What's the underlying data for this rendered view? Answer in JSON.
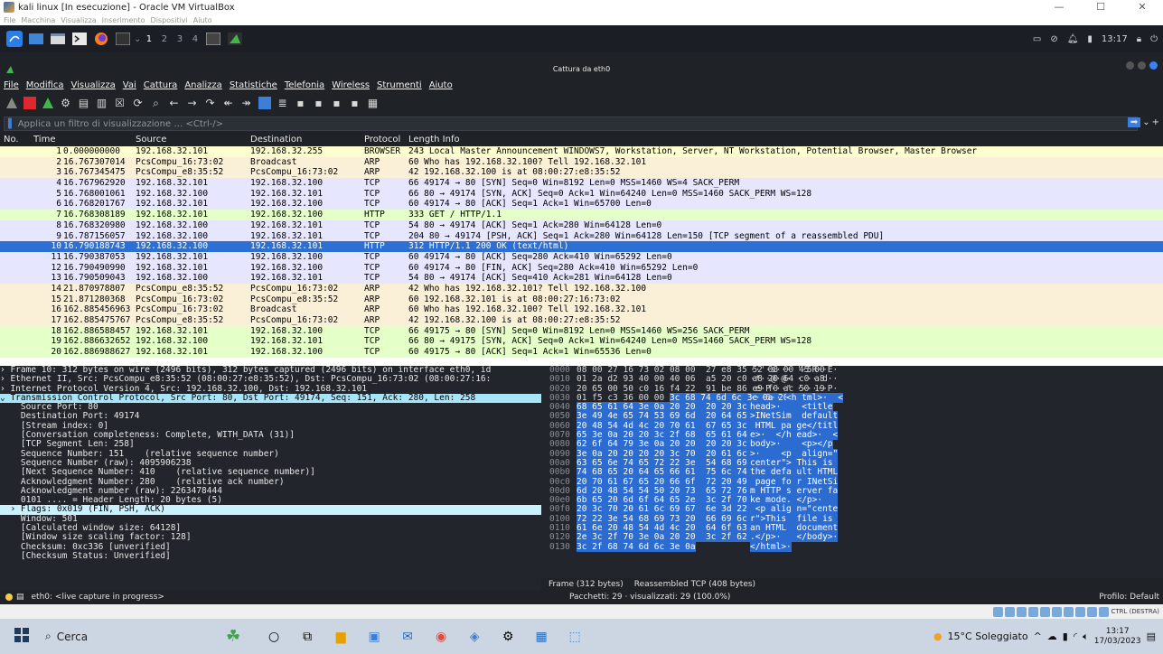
{
  "vbox": {
    "title": "kali linux [In esecuzione] - Oracle VM VirtualBox",
    "menu": [
      "File",
      "Macchina",
      "Visualizza",
      "Inserimento",
      "Dispositivi",
      "Aiuto"
    ]
  },
  "kali_panel": {
    "workspaces": [
      "1",
      "2",
      "3",
      "4"
    ],
    "time": "13:17"
  },
  "wireshark": {
    "window_title": "Cattura da eth0",
    "menu": [
      "File",
      "Modifica",
      "Visualizza",
      "Vai",
      "Cattura",
      "Analizza",
      "Statistiche",
      "Telefonia",
      "Wireless",
      "Strumenti",
      "Aiuto"
    ],
    "filter_placeholder": "Applica un filtro di visualizzazione … <Ctrl-/>",
    "columns": {
      "no": "No.",
      "time": "Time",
      "src": "Source",
      "dst": "Destination",
      "proto": "Protocol",
      "len_info": "Length Info"
    },
    "packets": [
      {
        "no": "1",
        "time": "0.000000000",
        "src": "192.168.32.101",
        "dst": "192.168.32.255",
        "proto": "BROWSER",
        "info": "243 Local Master Announcement WINDOWS7, Workstation, Server, NT Workstation, Potential Browser, Master Browser",
        "bg": "#feffd0"
      },
      {
        "no": "2",
        "time": "16.767307014",
        "src": "PcsCompu_16:73:02",
        "dst": "Broadcast",
        "proto": "ARP",
        "info": "60 Who has 192.168.32.100? Tell 192.168.32.101",
        "bg": "#faf0d7"
      },
      {
        "no": "3",
        "time": "16.767345475",
        "src": "PcsCompu_e8:35:52",
        "dst": "PcsCompu_16:73:02",
        "proto": "ARP",
        "info": "42 192.168.32.100 is at 08:00:27:e8:35:52",
        "bg": "#faf0d7"
      },
      {
        "no": "4",
        "time": "16.767962920",
        "src": "192.168.32.101",
        "dst": "192.168.32.100",
        "proto": "TCP",
        "info": "66 49174 → 80 [SYN] Seq=0 Win=8192 Len=0 MSS=1460 WS=4 SACK_PERM",
        "bg": "#e7e6ff"
      },
      {
        "no": "5",
        "time": "16.768001061",
        "src": "192.168.32.100",
        "dst": "192.168.32.101",
        "proto": "TCP",
        "info": "66 80 → 49174 [SYN, ACK] Seq=0 Ack=1 Win=64240 Len=0 MSS=1460 SACK_PERM WS=128",
        "bg": "#e7e6ff"
      },
      {
        "no": "6",
        "time": "16.768201767",
        "src": "192.168.32.101",
        "dst": "192.168.32.100",
        "proto": "TCP",
        "info": "60 49174 → 80 [ACK] Seq=1 Ack=1 Win=65700 Len=0",
        "bg": "#e7e6ff"
      },
      {
        "no": "7",
        "time": "16.768308189",
        "src": "192.168.32.101",
        "dst": "192.168.32.100",
        "proto": "HTTP",
        "info": "333 GET / HTTP/1.1",
        "bg": "#e4ffc7"
      },
      {
        "no": "8",
        "time": "16.768320980",
        "src": "192.168.32.100",
        "dst": "192.168.32.101",
        "proto": "TCP",
        "info": "54 80 → 49174 [ACK] Seq=1 Ack=280 Win=64128 Len=0",
        "bg": "#e7e6ff"
      },
      {
        "no": "9",
        "time": "16.787156057",
        "src": "192.168.32.100",
        "dst": "192.168.32.101",
        "proto": "TCP",
        "info": "204 80 → 49174 [PSH, ACK] Seq=1 Ack=280 Win=64128 Len=150 [TCP segment of a reassembled PDU]",
        "bg": "#e7e6ff"
      },
      {
        "no": "10",
        "time": "16.790188743",
        "src": "192.168.32.100",
        "dst": "192.168.32.101",
        "proto": "HTTP",
        "info": "312 HTTP/1.1 200 OK  (text/html)",
        "bg": "#2d70d5",
        "sel": true
      },
      {
        "no": "11",
        "time": "16.790387053",
        "src": "192.168.32.101",
        "dst": "192.168.32.100",
        "proto": "TCP",
        "info": "60 49174 → 80 [ACK] Seq=280 Ack=410 Win=65292 Len=0",
        "bg": "#e7e6ff"
      },
      {
        "no": "12",
        "time": "16.790490990",
        "src": "192.168.32.101",
        "dst": "192.168.32.100",
        "proto": "TCP",
        "info": "60 49174 → 80 [FIN, ACK] Seq=280 Ack=410 Win=65292 Len=0",
        "bg": "#e7e6ff"
      },
      {
        "no": "13",
        "time": "16.790509043",
        "src": "192.168.32.100",
        "dst": "192.168.32.101",
        "proto": "TCP",
        "info": "54 80 → 49174 [ACK] Seq=410 Ack=281 Win=64128 Len=0",
        "bg": "#e7e6ff"
      },
      {
        "no": "14",
        "time": "21.870978807",
        "src": "PcsCompu_e8:35:52",
        "dst": "PcsCompu_16:73:02",
        "proto": "ARP",
        "info": "42 Who has 192.168.32.101? Tell 192.168.32.100",
        "bg": "#faf0d7"
      },
      {
        "no": "15",
        "time": "21.871280368",
        "src": "PcsCompu_16:73:02",
        "dst": "PcsCompu_e8:35:52",
        "proto": "ARP",
        "info": "60 192.168.32.101 is at 08:00:27:16:73:02",
        "bg": "#faf0d7"
      },
      {
        "no": "16",
        "time": "162.885456963",
        "src": "PcsCompu_16:73:02",
        "dst": "Broadcast",
        "proto": "ARP",
        "info": "60 Who has 192.168.32.100? Tell 192.168.32.101",
        "bg": "#faf0d7"
      },
      {
        "no": "17",
        "time": "162.885475767",
        "src": "PcsCompu_e8:35:52",
        "dst": "PcsCompu_16:73:02",
        "proto": "ARP",
        "info": "42 192.168.32.100 is at 08:00:27:e8:35:52",
        "bg": "#faf0d7"
      },
      {
        "no": "18",
        "time": "162.886588457",
        "src": "192.168.32.101",
        "dst": "192.168.32.100",
        "proto": "TCP",
        "info": "66 49175 → 80 [SYN] Seq=0 Win=8192 Len=0 MSS=1460 WS=256 SACK_PERM",
        "bg": "#e4ffc7"
      },
      {
        "no": "19",
        "time": "162.886632652",
        "src": "192.168.32.100",
        "dst": "192.168.32.101",
        "proto": "TCP",
        "info": "66 80 → 49175 [SYN, ACK] Seq=0 Ack=1 Win=64240 Len=0 MSS=1460 SACK_PERM WS=128",
        "bg": "#e4ffc7"
      },
      {
        "no": "20",
        "time": "162.886988627",
        "src": "192.168.32.101",
        "dst": "192.168.32.100",
        "proto": "TCP",
        "info": "60 49175 → 80 [ACK] Seq=1 Ack=1 Win=65536 Len=0",
        "bg": "#e4ffc7"
      }
    ],
    "details": [
      {
        "t": "› Frame 10: 312 bytes on wire (2496 bits), 312 bytes captured (2496 bits) on interface eth0, id",
        "c": ""
      },
      {
        "t": "› Ethernet II, Src: PcsCompu_e8:35:52 (08:00:27:e8:35:52), Dst: PcsCompu_16:73:02 (08:00:27:16:",
        "c": ""
      },
      {
        "t": "› Internet Protocol Version 4, Src: 192.168.32.100, Dst: 192.168.32.101",
        "c": ""
      },
      {
        "t": "⌄ Transmission Control Protocol, Src Port: 80, Dst Port: 49174, Seq: 151, Ack: 280, Len: 258",
        "c": "hl"
      },
      {
        "t": "    Source Port: 80",
        "c": ""
      },
      {
        "t": "    Destination Port: 49174",
        "c": ""
      },
      {
        "t": "    [Stream index: 0]",
        "c": ""
      },
      {
        "t": "    [Conversation completeness: Complete, WITH_DATA (31)]",
        "c": ""
      },
      {
        "t": "    [TCP Segment Len: 258]",
        "c": ""
      },
      {
        "t": "    Sequence Number: 151    (relative sequence number)",
        "c": ""
      },
      {
        "t": "    Sequence Number (raw): 4095906238",
        "c": ""
      },
      {
        "t": "    [Next Sequence Number: 410    (relative sequence number)]",
        "c": ""
      },
      {
        "t": "    Acknowledgment Number: 280    (relative ack number)",
        "c": ""
      },
      {
        "t": "    Acknowledgment number (raw): 2263478444",
        "c": ""
      },
      {
        "t": "    0101 .... = Header Length: 20 bytes (5)",
        "c": ""
      },
      {
        "t": "  › Flags: 0x019 (FIN, PSH, ACK)",
        "c": "hl2"
      },
      {
        "t": "    Window: 501",
        "c": ""
      },
      {
        "t": "    [Calculated window size: 64128]",
        "c": ""
      },
      {
        "t": "    [Window size scaling factor: 128]",
        "c": ""
      },
      {
        "t": "    Checksum: 0xc336 [unverified]",
        "c": ""
      },
      {
        "t": "    [Checksum Status: Unverified]",
        "c": ""
      }
    ],
    "bytes": [
      {
        "off": "0000",
        "hex": "08 00 27 16 73 02 08 00  27 e8 35 52 08 00 45 00",
        "hsel": "",
        "asc": "··'·s··· '·5R··E·",
        "asel": ""
      },
      {
        "off": "0010",
        "hex": "01 2a d2 93 40 00 40 06  a5 20 c0 a8 20 64 c0 a8",
        "hsel": "",
        "asc": "·*··@·@· · ·· d··",
        "asel": ""
      },
      {
        "off": "0020",
        "hex": "20 65 00 50 c0 16 f4 22  91 be 86 e9 f0 ac 50 19",
        "hsel": "",
        "asc": " e·P···\" ······P·",
        "asel": ""
      },
      {
        "off": "0030",
        "hex": "01 f5 c3 36 00 00 ",
        "hsel": "3c 68 74 6d 6c 3e 0a 20 20 3c",
        "asc": "···6·· ",
        "asel": "<h tml>·  <"
      },
      {
        "off": "0040",
        "hex": "",
        "hsel": "68 65 61 64 3e 0a 20 20  20 20 3c 74 69 74 6c 65",
        "asc": "",
        "asel": "head>·    <title"
      },
      {
        "off": "0050",
        "hex": "",
        "hsel": "3e 49 4e 65 74 53 69 6d  20 64 65 66 61 75 6c 74",
        "asc": "",
        "asel": ">INetSim  default"
      },
      {
        "off": "0060",
        "hex": "",
        "hsel": "20 48 54 4d 4c 20 70 61  67 65 3c 2f 74 69 74 6c",
        "asc": "",
        "asel": " HTML pa ge</titl"
      },
      {
        "off": "0070",
        "hex": "",
        "hsel": "65 3e 0a 20 20 3c 2f 68  65 61 64 3e 0a 20 20 3c",
        "asc": "",
        "asel": "e>·  </h ead>·  <"
      },
      {
        "off": "0080",
        "hex": "",
        "hsel": "62 6f 64 79 3e 0a 20 20  20 20 3c 70 3e 3c 2f 70",
        "asc": "",
        "asel": "body>·    <p></p"
      },
      {
        "off": "0090",
        "hex": "",
        "hsel": "3e 0a 20 20 20 20 3c 70  20 61 6c 69 67 6e 3d 22",
        "asc": "",
        "asel": ">·    <p  align=\""
      },
      {
        "off": "00a0",
        "hex": "",
        "hsel": "63 65 6e 74 65 72 22 3e  54 68 69 73 20 69 73 20",
        "asc": "",
        "asel": "center\"> This is "
      },
      {
        "off": "00b0",
        "hex": "",
        "hsel": "74 68 65 20 64 65 66 61  75 6c 74 20 48 54 4d 4c",
        "asc": "",
        "asel": "the defa ult HTML"
      },
      {
        "off": "00c0",
        "hex": "",
        "hsel": "20 70 61 67 65 20 66 6f  72 20 49 4e 65 74 53 69",
        "asc": "",
        "asel": " page fo r INetSi"
      },
      {
        "off": "00d0",
        "hex": "",
        "hsel": "6d 20 48 54 54 50 20 73  65 72 76 65 72 20 66 61",
        "asc": "",
        "asel": "m HTTP s erver fa"
      },
      {
        "off": "00e0",
        "hex": "",
        "hsel": "6b 65 20 6d 6f 64 65 2e  3c 2f 70 3e 0a 20 20 20",
        "asc": "",
        "asel": "ke mode. </p>·   "
      },
      {
        "off": "00f0",
        "hex": "",
        "hsel": "20 3c 70 20 61 6c 69 67  6e 3d 22 63 65 6e 74 65",
        "asc": "",
        "asel": " <p alig n=\"cente"
      },
      {
        "off": "0100",
        "hex": "",
        "hsel": "72 22 3e 54 68 69 73 20  66 69 6c 65 20 69 73 20",
        "asc": "",
        "asel": "r\">This  file is "
      },
      {
        "off": "0110",
        "hex": "",
        "hsel": "61 6e 20 48 54 4d 4c 20  64 6f 63 75 6d 65 6e 74",
        "asc": "",
        "asel": "an HTML  document"
      },
      {
        "off": "0120",
        "hex": "",
        "hsel": "2e 3c 2f 70 3e 0a 20 20  3c 2f 62 6f 64 79 3e 0a",
        "asc": "",
        "asel": ".</p>·   </body>·"
      },
      {
        "off": "0130",
        "hex": "",
        "hsel": "3c 2f 68 74 6d 6c 3e 0a",
        "asc": "",
        "asel": "</html>·"
      }
    ],
    "bytes_tabs": [
      "Frame (312 bytes)",
      "Reassembled TCP (408 bytes)"
    ],
    "status_left": "eth0: <live capture in progress>",
    "status_mid": "Pacchetti: 29 · visualizzati: 29 (100.0%)",
    "status_right": "Profilo: Default"
  },
  "vbox_status": {
    "hostkey": "CTRL (DESTRA)"
  },
  "taskbar": {
    "search": "Cerca",
    "weather": "15°C Soleggiato",
    "time": "13:17",
    "date": "17/03/2023"
  }
}
